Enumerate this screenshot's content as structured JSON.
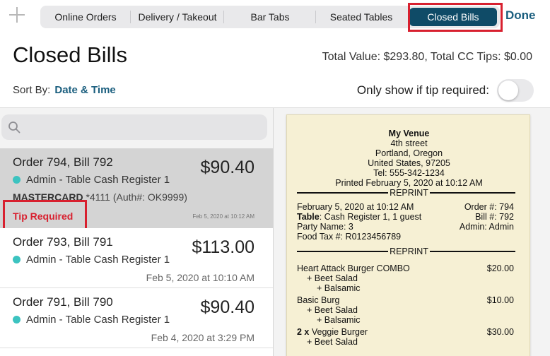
{
  "tabs": [
    {
      "label": "Online Orders"
    },
    {
      "label": "Delivery / Takeout"
    },
    {
      "label": "Bar Tabs"
    },
    {
      "label": "Seated Tables"
    },
    {
      "label": "Closed Bills"
    }
  ],
  "active_tab": "Closed Bills",
  "done_label": "Done",
  "page_title": "Closed Bills",
  "totals_text": "Total Value: $293.80, Total CC Tips: $0.00",
  "sort": {
    "label": "Sort By:",
    "value": "Date & Time"
  },
  "tip_filter": {
    "label": "Only show if tip required:",
    "enabled": false
  },
  "bills": [
    {
      "title": "Order 794, Bill 792",
      "register": "Admin - Table Cash Register 1",
      "amount": "$90.40",
      "card_brand": "MASTERCARD",
      "card_detail": " *4111 (Auth#: OK9999)",
      "tip_status": "Tip Required",
      "date": "Feb 5, 2020 at 10:12 AM",
      "selected": true
    },
    {
      "title": "Order 793, Bill 791",
      "register": "Admin - Table Cash Register 1",
      "amount": "$113.00",
      "date": "Feb 5, 2020 at 10:10 AM"
    },
    {
      "title": "Order 791, Bill 790",
      "register": "Admin - Table Cash Register 1",
      "amount": "$90.40",
      "date": "Feb 4, 2020 at 3:29 PM"
    }
  ],
  "receipt": {
    "venue": "My Venue",
    "address1": "4th street",
    "address2": "Portland, Oregon",
    "address3": "United States, 97205",
    "phone": "Tel: 555-342-1234",
    "printed": "Printed February 5, 2020 at 10:12 AM",
    "reprint_label": "REPRINT",
    "datetime": "February 5, 2020 at 10:12 AM",
    "order_no": "Order #: 794",
    "table_label": "Table",
    "table_value": ": Cash Register 1, 1 guest",
    "bill_no": "Bill #: 792",
    "party": "Party Name: 3",
    "admin": "Admin: Admin",
    "tax_id": "Food Tax #: R0123456789",
    "items": [
      {
        "name": "Heart Attack Burger COMBO",
        "price": "$20.00"
      },
      {
        "name": "+ Beet Salad"
      },
      {
        "name": "+ Balsamic"
      },
      {
        "name": "Basic Burg",
        "price": "$10.00"
      },
      {
        "name": "+ Beet Salad"
      },
      {
        "name": "+ Balsamic"
      },
      {
        "qty": "2 x",
        "name": " Veggie Burger",
        "price": "$30.00"
      },
      {
        "name": "+ Beet Salad"
      }
    ]
  },
  "colors": {
    "accent": "#0f4b67",
    "link": "#1a5e7e",
    "tip_required": "#d8202f",
    "status_dot": "#3cc3c0",
    "receipt_paper": "#f6f0d4"
  }
}
